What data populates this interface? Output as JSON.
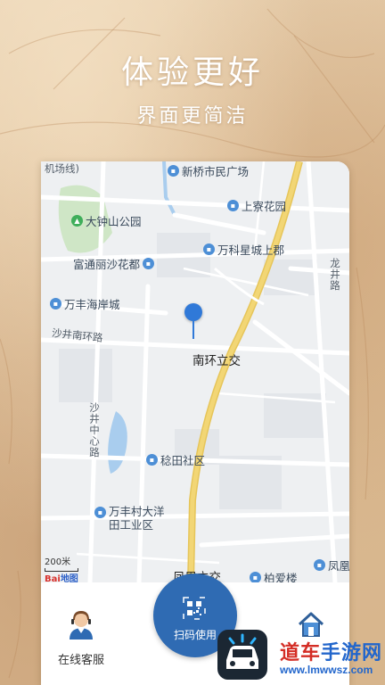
{
  "header": {
    "title": "体验更好",
    "subtitle": "界面更简洁"
  },
  "map": {
    "partial_top_label": "机场线)",
    "pois": [
      {
        "name": "新桥市民广场",
        "icon": "building-pin-icon"
      },
      {
        "name": "上寮花园",
        "icon": "building-pin-icon"
      },
      {
        "name": "大钟山公园",
        "icon": "park-pin-icon"
      },
      {
        "name": "万科星城上郡",
        "icon": "building-pin-icon"
      },
      {
        "name": "富通丽沙花都",
        "icon": "building-pin-icon"
      },
      {
        "name": "万丰海岸城",
        "icon": "building-pin-icon"
      },
      {
        "name": "稔田社区",
        "icon": "building-pin-icon"
      },
      {
        "name": "万丰村大洋田工业区",
        "icon": "building-pin-icon"
      },
      {
        "name": "柏爱楼",
        "icon": "building-pin-icon"
      },
      {
        "name": "凤凰",
        "icon": "building-pin-icon"
      }
    ],
    "roads": {
      "shajing_south_ring": "沙井南环路",
      "shajing_central": "沙井中心路",
      "longjing": "龙井路"
    },
    "places": {
      "south_ring_interchange": "南环立交",
      "fenghuang_interchange": "凤凰立交"
    },
    "scale": "200米",
    "logo": {
      "part1": "Bai",
      "part2": "地图"
    },
    "colors": {
      "marker": "#3079d8",
      "highway": "#f2d675",
      "poi_pin": "#4d8fd6"
    }
  },
  "bottom_nav": {
    "customer_service": "在线客服",
    "scan": "扫码使用",
    "home_icon": "home-icon"
  },
  "watermark": {
    "title_part1": "道车",
    "title_part2": "手游网",
    "url": "www.lmwwsz.com"
  }
}
